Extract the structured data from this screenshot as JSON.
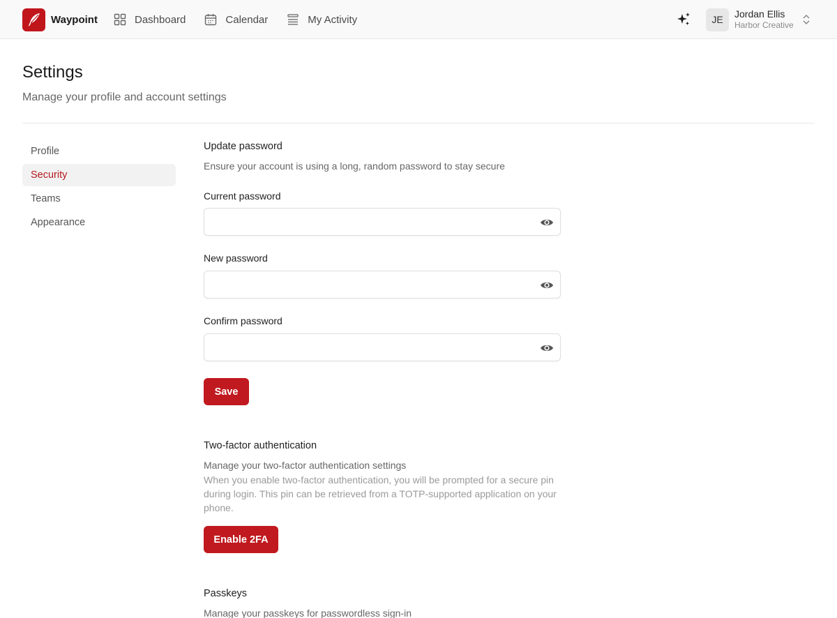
{
  "brand": {
    "name": "Waypoint"
  },
  "nav": [
    {
      "label": "Dashboard",
      "icon": "grid-icon"
    },
    {
      "label": "Calendar",
      "icon": "calendar-icon"
    },
    {
      "label": "My Activity",
      "icon": "list-icon"
    }
  ],
  "user": {
    "initials": "JE",
    "name": "Jordan Ellis",
    "org": "Harbor Creative"
  },
  "header": {
    "title": "Settings",
    "subtitle": "Manage your profile and account settings"
  },
  "sidebar": {
    "items": [
      {
        "label": "Profile",
        "active": false
      },
      {
        "label": "Security",
        "active": true
      },
      {
        "label": "Teams",
        "active": false
      },
      {
        "label": "Appearance",
        "active": false
      }
    ]
  },
  "password": {
    "title": "Update password",
    "description": "Ensure your account is using a long, random password to stay secure",
    "current_label": "Current password",
    "new_label": "New password",
    "confirm_label": "Confirm password",
    "current_value": "",
    "new_value": "",
    "confirm_value": "",
    "save_label": "Save"
  },
  "twofa": {
    "title": "Two-factor authentication",
    "description": "Manage your two-factor authentication settings",
    "info": "When you enable two-factor authentication, you will be prompted for a secure pin during login. This pin can be retrieved from a TOTP-supported application on your phone.",
    "button_label": "Enable 2FA"
  },
  "passkeys": {
    "title": "Passkeys",
    "description": "Manage your passkeys for passwordless sign-in"
  },
  "colors": {
    "accent": "#c0191f",
    "active_text": "#b5191f",
    "topbar_bg": "#f9f9f9"
  }
}
